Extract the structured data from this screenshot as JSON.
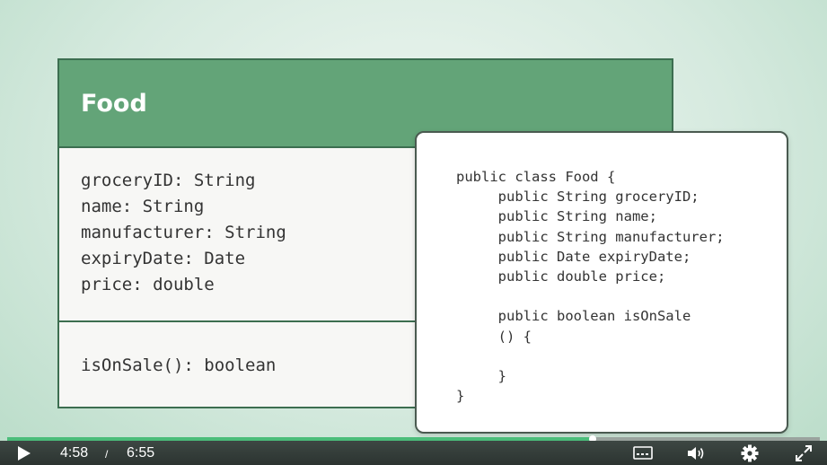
{
  "uml": {
    "class_name": "Food",
    "attributes": [
      "groceryID: String",
      "name: String",
      "manufacturer: String",
      "expiryDate: Date",
      "price: double"
    ],
    "methods": [
      "isOnSale(): boolean"
    ]
  },
  "code": {
    "lines": [
      "public class Food {",
      "     public String groceryID;",
      "     public String name;",
      "     public String manufacturer;",
      "     public Date expiryDate;",
      "     public double price;",
      "",
      "     public boolean isOnSale",
      "     () {",
      "",
      "     }",
      "}"
    ]
  },
  "player": {
    "current_time": "4:58",
    "separator": "/",
    "duration": "6:55",
    "progress_fraction": 0.72,
    "colors": {
      "progress": "#4bbd7a",
      "bar": "#333b38"
    },
    "icons": [
      "play-icon",
      "captions-icon",
      "volume-icon",
      "settings-icon",
      "fullscreen-icon"
    ]
  }
}
